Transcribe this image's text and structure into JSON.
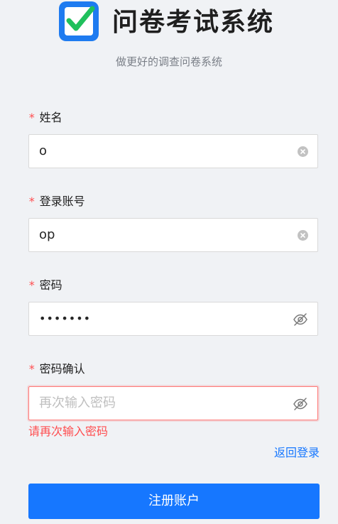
{
  "header": {
    "app_title": "问卷考试系统",
    "subtitle": "做更好的调查问卷系统",
    "logo_icon": "checkbox-check-icon"
  },
  "form": {
    "required_mark": "*",
    "name": {
      "label": "姓名",
      "value": "o",
      "icon": "clear-icon"
    },
    "account": {
      "label": "登录账号",
      "value": "op",
      "icon": "clear-icon"
    },
    "password": {
      "label": "密码",
      "value": "•••••••",
      "icon": "eye-slash-icon"
    },
    "confirm": {
      "label": "密码确认",
      "placeholder": "再次输入密码",
      "value": "",
      "icon": "eye-slash-icon",
      "error": "请再次输入密码"
    },
    "back_link": "返回登录",
    "submit": "注册账户"
  },
  "colors": {
    "primary": "#1677ff",
    "error": "#ff4d4f",
    "logo_check": "#22c55e",
    "background": "#f0f2f5"
  }
}
